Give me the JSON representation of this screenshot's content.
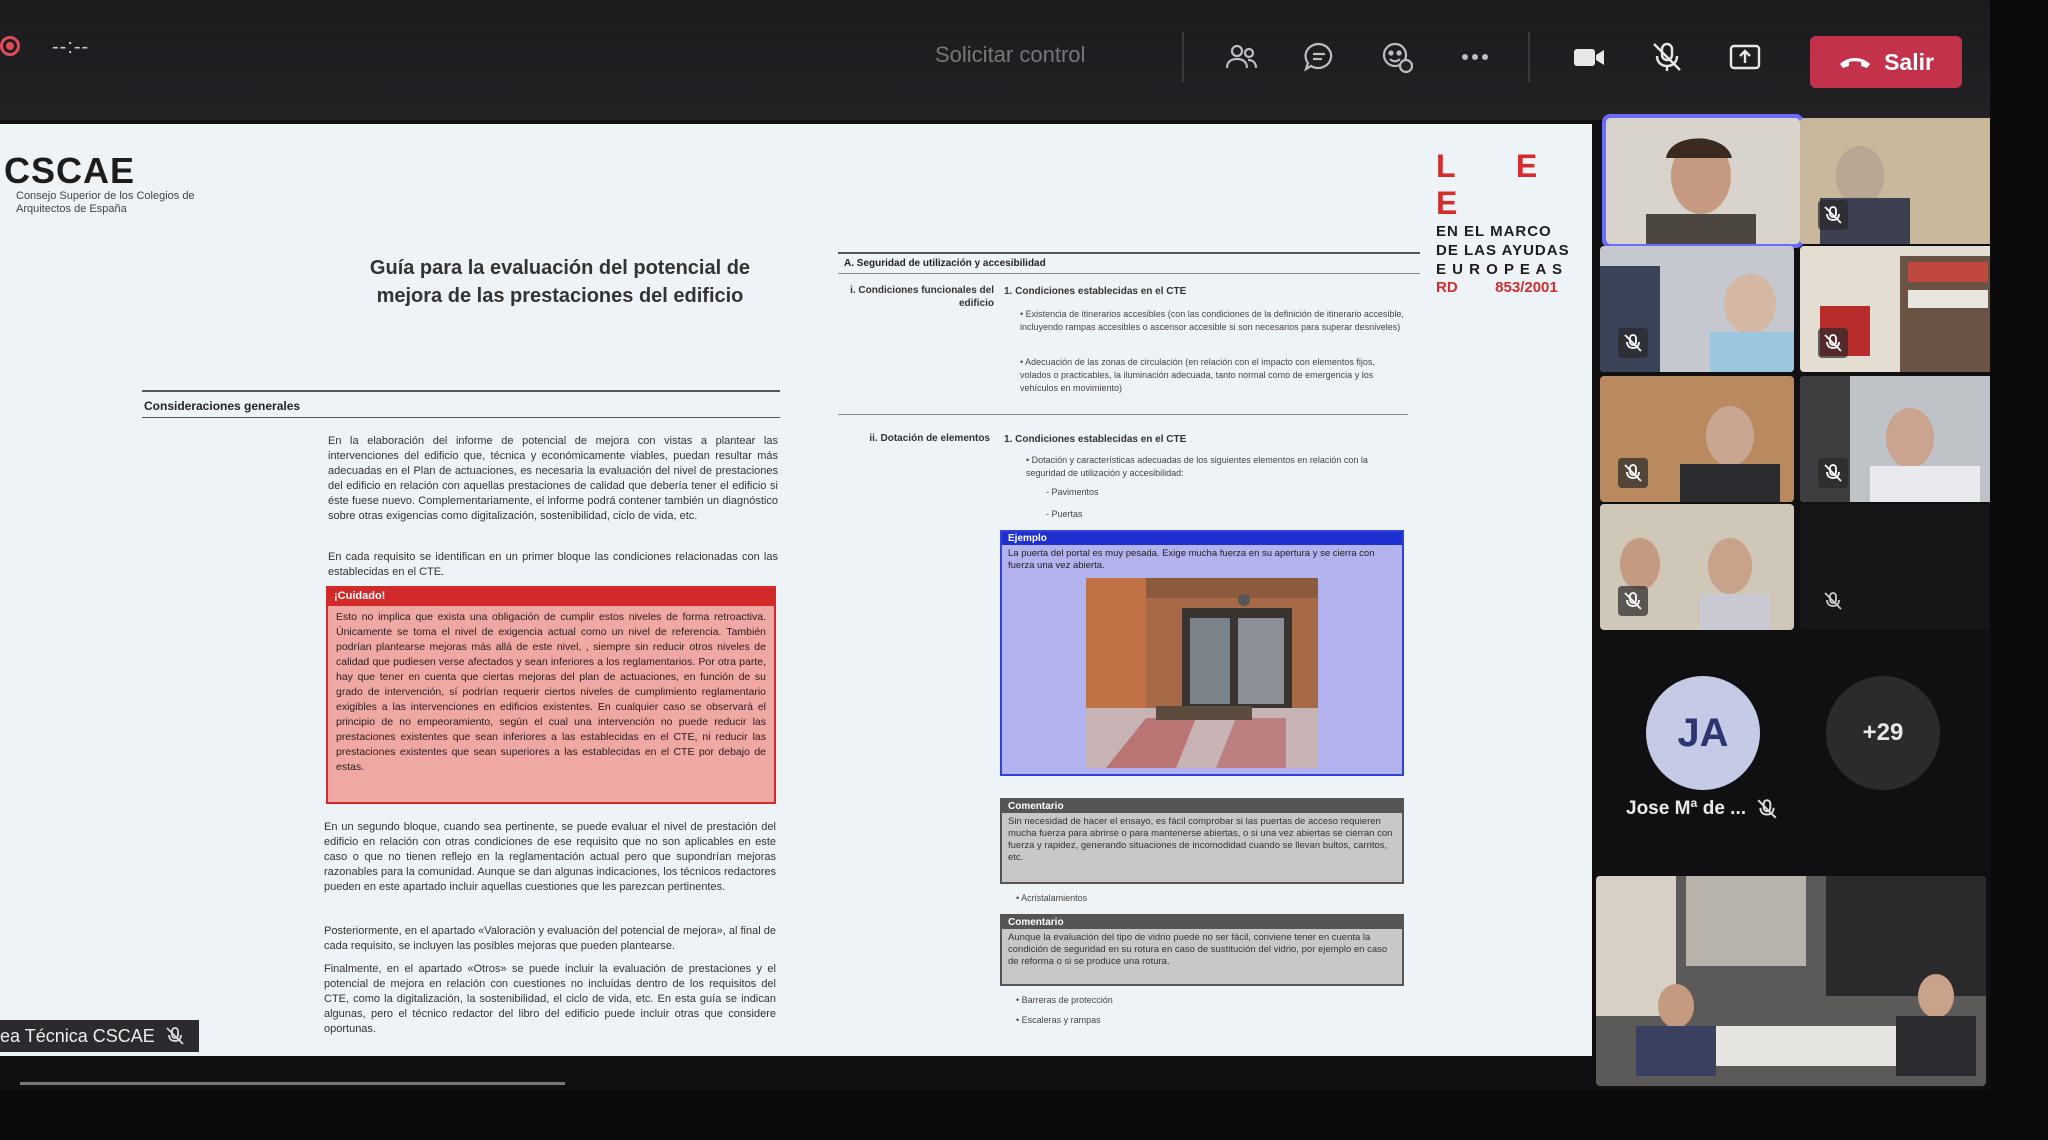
{
  "toolbar": {
    "timer": "--:--",
    "request_control": "Solicitar control",
    "leave_label": "Salir",
    "colors": {
      "leave": "#c4314b",
      "active_speaker": "#6b6bff"
    }
  },
  "slide": {
    "logo": "CSCAE",
    "logo_sub": "Consejo Superior de los Colegios de Arquitectos de España",
    "lee_letters": "L E E",
    "lee_line1": "EN EL MARCO",
    "lee_line2": "DE LAS AYUDAS",
    "lee_line3": "E U R O P E A S",
    "lee_rd": "RD         853/2001",
    "title": "Guía para la evaluación del potencial de mejora de las prestaciones del edificio",
    "section_left": "Consideraciones generales",
    "para1": "En la elaboración del informe de potencial de mejora con vistas a plantear las intervenciones del edificio que, técnica y económicamente viables, puedan resultar más adecuadas en el Plan de actuaciones, es necesaria la evaluación del nivel de prestaciones del edificio en relación con aquellas prestaciones de calidad que debería tener el edificio si éste fuese nuevo. Complementariamente, el informe podrá contener también un diagnóstico sobre otras exigencias como digitalización, sostenibilidad, ciclo de vida, etc.",
    "para2": "En cada requisito se identifican en un primer bloque las condiciones relacionadas con las establecidas en el CTE.",
    "caution_title": "¡Cuidado!",
    "caution_text": "Esto no implica que exista una obligación de cumplir estos niveles de forma retroactiva. Únicamente se toma el nivel de exigencia actual como un nivel de referencia. También podrían plantearse mejoras más allá de este nivel, , siempre sin reducir otros niveles de calidad que pudiesen verse afectados y sean inferiores a los reglamentarios. Por otra parte, hay que tener en cuenta que ciertas mejoras del plan de actuaciones, en función de su grado de intervención, sí podrían requerir ciertos niveles de cumplimiento reglamentario exigibles a las intervenciones en edificios existentes. En cualquier caso se observará el principio de no empeoramiento, según el cual una intervención no puede reducir las prestaciones existentes que sean inferiores a las establecidas en el CTE, ni reducir las prestaciones existentes que sean superiores a las establecidas en el CTE por debajo de estas.",
    "para3": "En un segundo bloque, cuando sea pertinente, se puede evaluar el nivel de prestación del edificio en relación con otras condiciones de ese requisito que no son aplicables en este caso o que no tienen reflejo en la reglamentación actual pero que supondrían mejoras razonables para la comunidad. Aunque se dan algunas indicaciones, los técnicos redactores pueden en este apartado incluir aquellas cuestiones que les parezcan pertinentes.",
    "para4": "Posteriormente, en el apartado «Valoración y evaluación del potencial de mejora», al final de cada requisito, se incluyen las posibles mejoras que pueden plantearse.",
    "para5": "Finalmente, en el apartado «Otros» se puede incluir la evaluación de prestaciones y el potencial de mejora en relación con cuestiones no incluidas dentro de los requisitos del CTE, como la digitalización, la sostenibilidad, el ciclo de vida, etc. En esta guía se indican algunas, pero el técnico redactor del libro del edificio puede incluir otras que considere oportunas.",
    "right_section": "A.  Seguridad de utilización y accesibilidad",
    "label_i": "i.  Condiciones funcionales del edificio",
    "label_ii": "ii.  Dotación de elementos",
    "sub1": "1.  Condiciones establecidas en el CTE",
    "sub2": "1.  Condiciones establecidas en el CTE",
    "bullet1": "Existencia de itinerarios accesibles (con las condiciones de la definición de itinerario accesible, incluyendo rampas accesibles o ascensor accesible si son necesarios para superar desniveles)",
    "bullet2": "Adecuación de las zonas de circulación (en relación con el impacto con elementos fijos, volados o practicables, la iluminación adecuada, tanto normal como de emergencia y los vehículos en movimiento)",
    "bullet3": "Dotación y características adecuadas de los siguientes elementos en relación con la seguridad de utilización y accesibilidad:",
    "sub_b1": "-  Pavimentos",
    "sub_b2": "-  Puertas",
    "example_title": "Ejemplo",
    "example_text": "La puerta del portal es muy pesada. Exige mucha fuerza en su apertura y se cierra con fuerza una vez abierta.",
    "comment1_title": "Comentario",
    "comment1_text": "Sin necesidad de hacer el ensayo, es fácil comprobar si las puertas de acceso requieren mucha fuerza para abrirse o para mantenerse abiertas, o si una vez abiertas se cierran con fuerza y rapidez, generando situaciones de incomodidad cuando se llevan bultos, carritos, etc.",
    "bullet4": "Acristalamientos",
    "comment2_title": "Comentario",
    "comment2_text": "Aunque la evaluación del tipo de vidrio puede no ser fácil, conviene tener en cuenta la condición de seguridad en su rotura en caso de sustitución del vidrio, por ejemplo en caso de reforma o si se produce una rotura.",
    "bullet5": "Barreras de protección",
    "bullet6": "Escaleras y rampas"
  },
  "presenter_tag": "ea Técnica CSCAE",
  "participants": {
    "avatar_initials": "JA",
    "avatar_name": "Jose Mª de ...",
    "overflow_count": "+29"
  }
}
